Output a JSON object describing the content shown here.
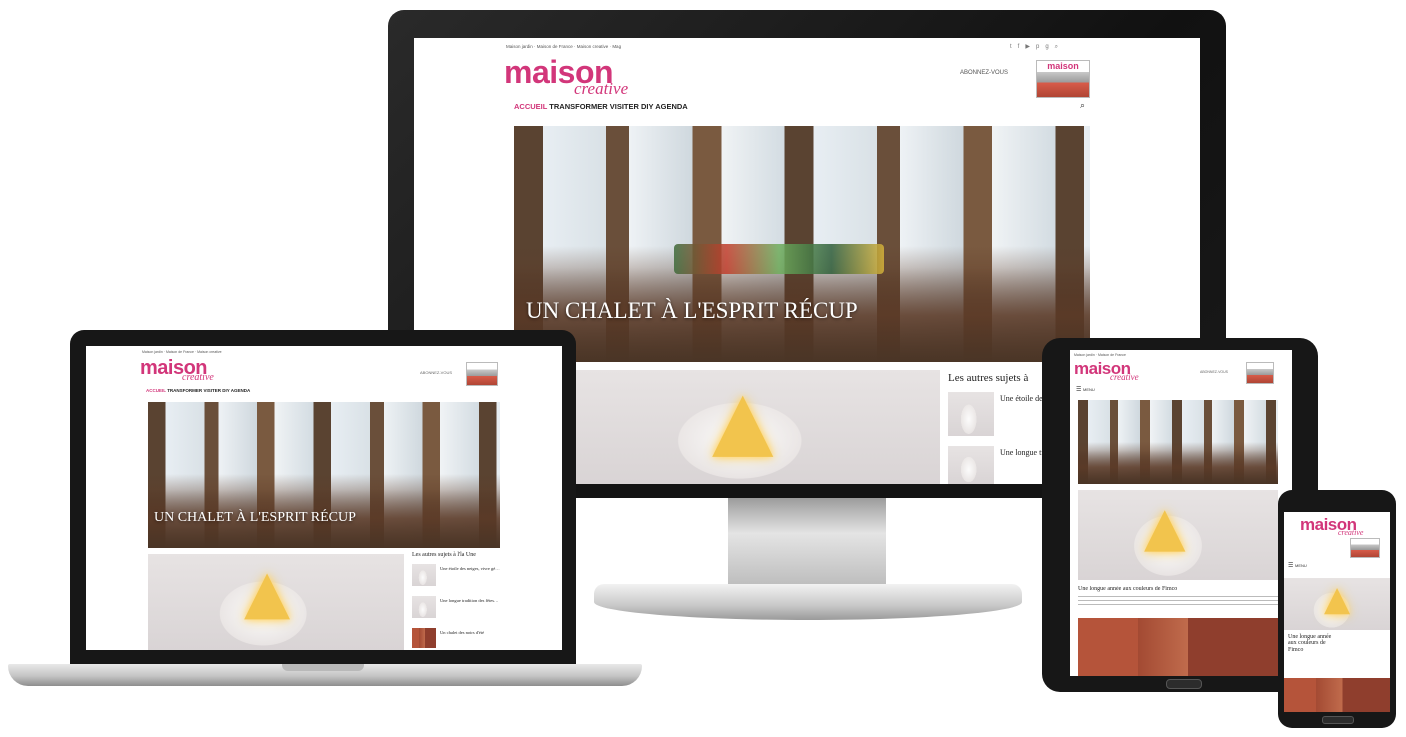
{
  "site": {
    "logo_main": "maison",
    "logo_sub": "creative",
    "top_links": [
      "Maison jardin",
      "Maison de France",
      "Maison creative",
      "Mag"
    ],
    "subscribe": "ABONNEZ-VOUS",
    "mag_badge": "maison"
  },
  "nav": {
    "items": [
      "ACCUEIL",
      "TRANSFORMER",
      "VISITER",
      "DIY",
      "AGENDA"
    ],
    "menu_label": "MENU"
  },
  "hero": {
    "title": "UN CHALET À L'ESPRIT RÉCUP"
  },
  "sidebar": {
    "heading": "Les autres sujets à l'la Une",
    "heading_desktop": "Les autres sujets à",
    "items": [
      {
        "title": "Une étoile des neiges, vivre gé…"
      },
      {
        "title": "Une longue tradition des fêtes…"
      },
      {
        "title": "Un chalet des noirs d'été"
      }
    ]
  },
  "article": {
    "title": "Une longue année aux couleurs de Fimco",
    "title_phone": "Une longue année aux couleurs de Fimco"
  },
  "icons": {
    "social": [
      "twitter-icon",
      "facebook-icon",
      "youtube-icon",
      "pinterest-icon",
      "google-plus-icon",
      "search-icon"
    ]
  },
  "colors": {
    "brand": "#d2367a",
    "bezel": "#171717"
  }
}
